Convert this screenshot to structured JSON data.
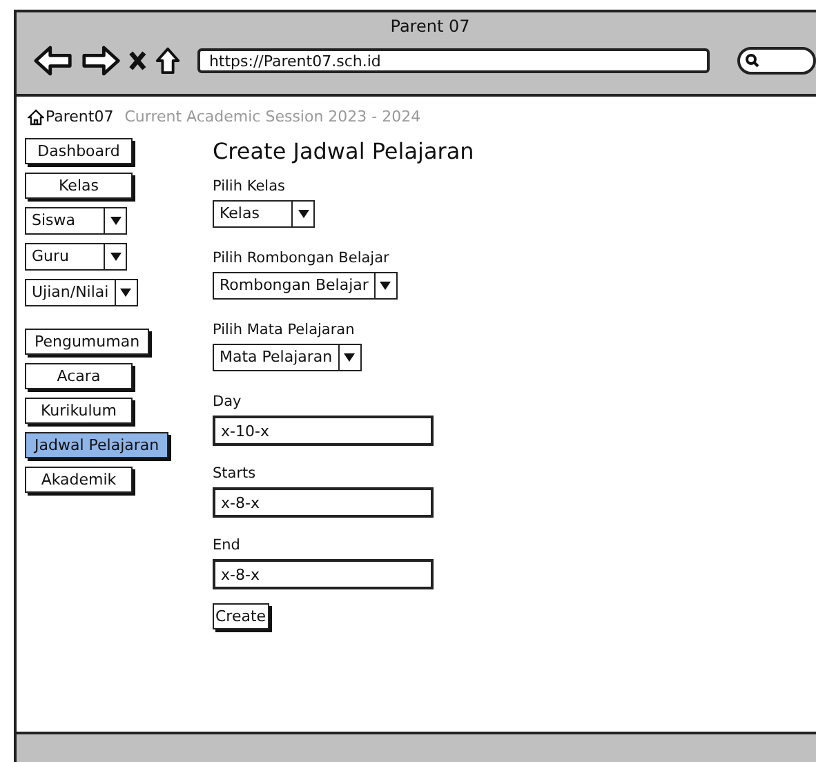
{
  "window": {
    "title": "Parent 07",
    "url": "https://Parent07.sch.id"
  },
  "breadcrumb": {
    "home": "Parent07",
    "session": "Current Academic Session 2023 - 2024"
  },
  "sidebar": {
    "groups": [
      [
        {
          "kind": "button",
          "label": "Dashboard",
          "selected": false
        },
        {
          "kind": "button",
          "label": "Kelas",
          "selected": false
        },
        {
          "kind": "dropdown",
          "label": "Siswa"
        },
        {
          "kind": "dropdown",
          "label": "Guru"
        },
        {
          "kind": "dropdown",
          "label": "Ujian/Nilai"
        }
      ],
      [
        {
          "kind": "button",
          "label": "Pengumuman",
          "selected": false
        },
        {
          "kind": "button",
          "label": "Acara",
          "selected": false
        },
        {
          "kind": "button",
          "label": "Kurikulum",
          "selected": false
        },
        {
          "kind": "button",
          "label": "Jadwal Pelajaran",
          "selected": true
        },
        {
          "kind": "button",
          "label": "Akademik",
          "selected": false
        }
      ]
    ]
  },
  "form": {
    "title": "Create Jadwal Pelajaran",
    "fields": [
      {
        "kind": "dropdown",
        "label": "Pilih Kelas",
        "value": "Kelas"
      },
      {
        "kind": "dropdown",
        "label": "Pilih Rombongan Belajar",
        "value": "Rombongan Belajar"
      },
      {
        "kind": "dropdown",
        "label": "Pilih Mata Pelajaran",
        "value": "Mata Pelajaran"
      },
      {
        "kind": "text",
        "label": "Day",
        "value": "x-10-x"
      },
      {
        "kind": "text",
        "label": "Starts",
        "value": "x-8-x"
      },
      {
        "kind": "text",
        "label": "End",
        "value": "x-8-x"
      }
    ],
    "submit": "Create"
  }
}
